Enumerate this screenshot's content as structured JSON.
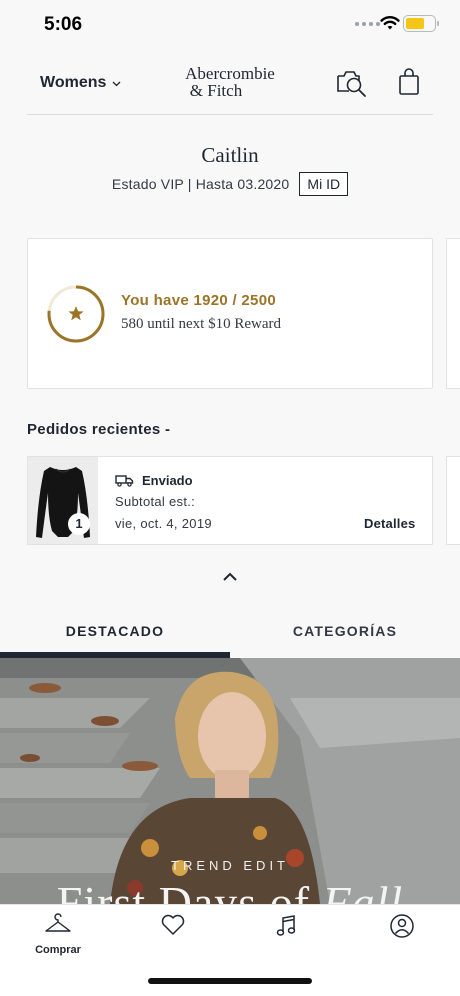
{
  "status_bar": {
    "time": "5:06"
  },
  "header": {
    "category_selector": "Womens",
    "logo_line1": "Abercrombie",
    "logo_line2": "& Fitch"
  },
  "profile": {
    "name": "Caitlin",
    "status": "Estado VIP | Hasta 03.2020",
    "id_button": "Mi ID"
  },
  "rewards": {
    "points_text": "You have 1920 / 2500",
    "next_reward_text": "580 until next $10 Reward",
    "progress": 0.768,
    "accent_color": "#9c7428"
  },
  "orders": {
    "title": "Pedidos recientes -",
    "items": [
      {
        "status": "Enviado",
        "subtotal_label": "Subtotal est.:",
        "date": "vie, oct. 4, 2019",
        "details_link": "Detalles",
        "quantity": "1"
      }
    ]
  },
  "tabs": [
    {
      "label": "DESTACADO",
      "active": true
    },
    {
      "label": "CATEGORÍAS",
      "active": false
    }
  ],
  "hero": {
    "eyebrow": "TREND EDIT",
    "title_part1": "First Days of ",
    "title_part2": "Fall"
  },
  "bottom_nav": [
    {
      "label": "Comprar",
      "icon": "hanger-icon"
    },
    {
      "label": "",
      "icon": "heart-icon"
    },
    {
      "label": "",
      "icon": "music-note-icon"
    },
    {
      "label": "",
      "icon": "account-icon"
    }
  ],
  "colors": {
    "navy": "#1f2733",
    "gold": "#9c7428",
    "battery": "#f5c518"
  }
}
